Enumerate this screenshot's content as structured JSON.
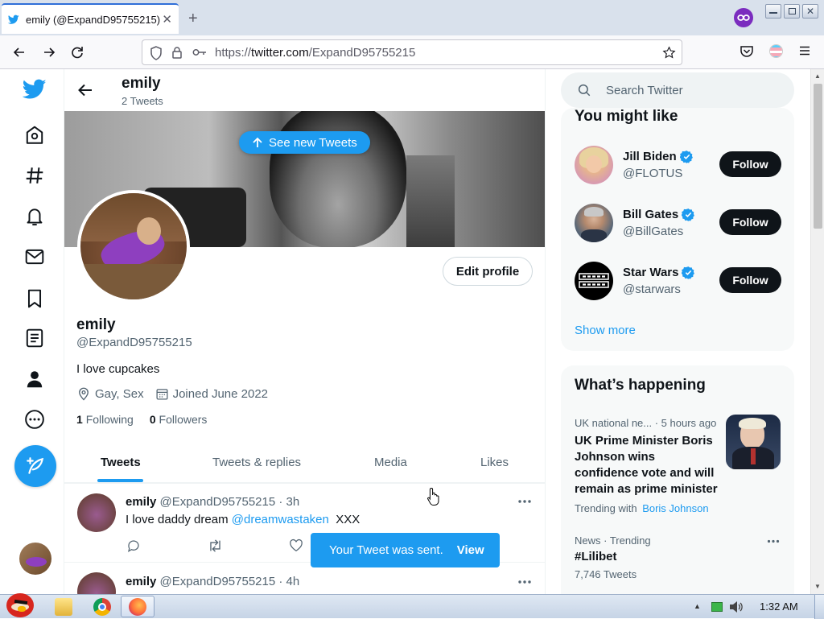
{
  "browser": {
    "tab_title": "emily (@ExpandD95755215) / Twitter",
    "url_scheme": "https://",
    "url_host": "twitter.com",
    "url_path": "/ExpandD95755215"
  },
  "header": {
    "name": "emily",
    "tweet_count": "2 Tweets"
  },
  "banner": {
    "new_tweets_label": "See new Tweets"
  },
  "profile": {
    "edit_label": "Edit profile",
    "name": "emily",
    "handle": "@ExpandD95755215",
    "bio": "I love cupcakes",
    "location": "Gay, Sex",
    "joined": "Joined June 2022",
    "following_count": "1",
    "following_label": "Following",
    "followers_count": "0",
    "followers_label": "Followers"
  },
  "tabs": [
    {
      "label": "Tweets",
      "active": true
    },
    {
      "label": "Tweets & replies",
      "active": false
    },
    {
      "label": "Media",
      "active": false
    },
    {
      "label": "Likes",
      "active": false
    }
  ],
  "tweets": [
    {
      "name": "emily",
      "handle": "@ExpandD95755215",
      "time": "· 3h",
      "text_before": "I love daddy dream ",
      "mention": "@dreamwastaken",
      "text_after": "  XXX"
    },
    {
      "name": "emily",
      "handle": "@ExpandD95755215",
      "time": "· 4h"
    }
  ],
  "toast": {
    "message": "Your Tweet was sent.",
    "action": "View"
  },
  "search": {
    "placeholder": "Search Twitter"
  },
  "you_might_like": {
    "title": "You might like",
    "show_more": "Show more",
    "users": [
      {
        "name": "Jill Biden",
        "handle": "@FLOTUS",
        "button": "Follow",
        "verified": true
      },
      {
        "name": "Bill Gates",
        "handle": "@BillGates",
        "button": "Follow",
        "verified": true
      },
      {
        "name": "Star Wars",
        "handle": "@starwars",
        "button": "Follow",
        "verified": true
      }
    ]
  },
  "whats_happening": {
    "title": "What’s happening",
    "items": [
      {
        "meta_category": "UK national ne...",
        "meta_time": " · 5 hours ago",
        "headline": "UK Prime Minister Boris Johnson wins confidence vote and will remain as prime minister",
        "trending_with_label": "Trending with",
        "trending_with_link": "Boris Johnson"
      },
      {
        "meta": "News · Trending",
        "topic": "#Lilibet",
        "count": "7,746 Tweets"
      }
    ]
  },
  "taskbar": {
    "clock": "1:32 AM"
  },
  "colors": {
    "twitter_blue": "#1d9bf0",
    "text_primary": "#0f1419",
    "text_secondary": "#536471",
    "verified": "#1d9bf0"
  }
}
